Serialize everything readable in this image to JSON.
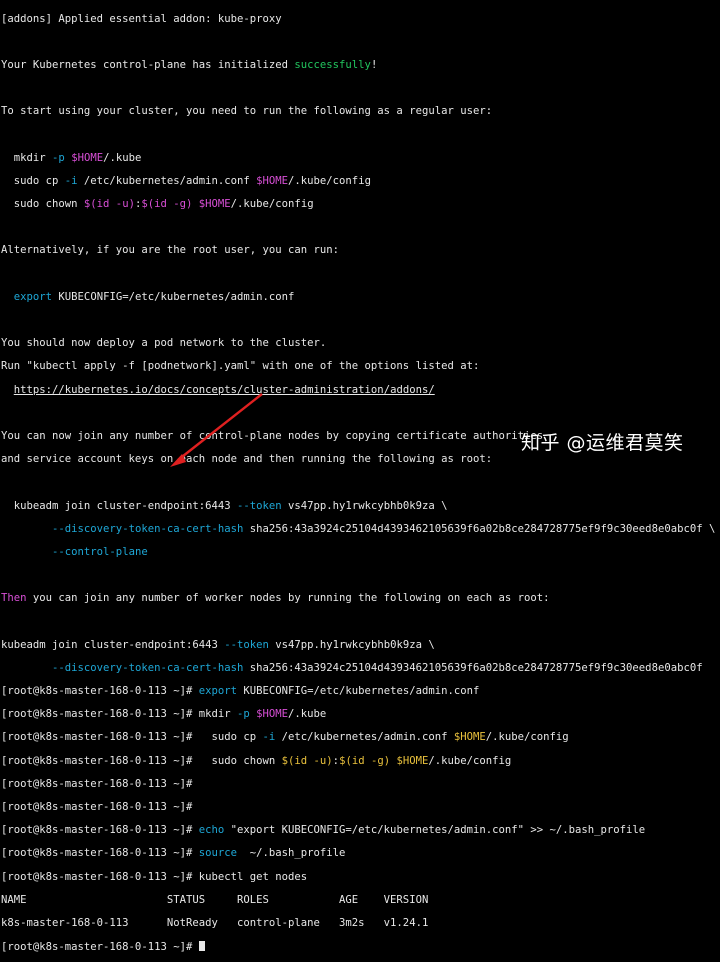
{
  "terminal": {
    "l1": "[addons] Applied essential addon: kube-proxy",
    "l3a": "Your Kubernetes control-plane has initialized ",
    "l3b": "successfully",
    "l3c": "!",
    "l5": "To start using your cluster, you need to run the following as a regular user:",
    "l7a": "  mkdir ",
    "l7b": "-p",
    "l7c": " ",
    "l7d": "$HOME",
    "l7e": "/.kube",
    "l8a": "  sudo cp ",
    "l8b": "-i",
    "l8c": " /etc/kubernetes/admin.conf ",
    "l8d": "$HOME",
    "l8e": "/.kube/config",
    "l9a": "  sudo chown ",
    "l9b": "$(id -u)",
    "l9c": ":",
    "l9d": "$(id -g)",
    "l9e": " ",
    "l9f": "$HOME",
    "l9g": "/.kube/config",
    "l11": "Alternatively, if you are the root user, you can run:",
    "l13a": "  ",
    "l13b": "export",
    "l13c": " KUBECONFIG=/etc/kubernetes/admin.conf",
    "l15": "You should now deploy a pod network to the cluster.",
    "l16": "Run \"kubectl apply -f [podnetwork].yaml\" with one of the options listed at:",
    "l17a": "  ",
    "l17b": "https://kubernetes.io/docs/concepts/cluster-administration/addons/",
    "l19": "You can now join any number of control-plane nodes by copying certificate authorities",
    "l20": "and service account keys on each node and then running the following as root:",
    "l22a": "  kubeadm join cluster-endpoint:6443 ",
    "l22b": "--token",
    "l22c": " vs47pp.hy1rwkcybhb0k9za \\",
    "l23a": "        ",
    "l23b": "--discovery-token-ca-cert-hash",
    "l23c": " sha256:43a3924c25104d4393462105639f6a02b8ce284728775ef9f9c30eed8e0abc0f \\",
    "l24a": "        ",
    "l24b": "--control-plane",
    "l26a": "Then",
    "l26b": " you can join any number of worker nodes by running the following on each as root:",
    "l28a": "kubeadm join cluster-endpoint:6443 ",
    "l28b": "--token",
    "l28c": " vs47pp.hy1rwkcybhb0k9za \\",
    "l29a": "        ",
    "l29b": "--discovery-token-ca-cert-hash",
    "l29c": " sha256:43a3924c25104d4393462105639f6a02b8ce284728775ef9f9c30eed8e0abc0f",
    "prompt": "[root@k8s-master-168-0-113 ~]# ",
    "l30a": "export",
    "l30b": " KUBECONFIG=/etc/kubernetes/admin.conf",
    "l31a": "mkdir ",
    "l31b": "-p",
    "l31c": " ",
    "l31d": "$HOME",
    "l31e": "/.kube",
    "l32a": "  sudo cp ",
    "l32b": "-i",
    "l32c": " /etc/kubernetes/admin.conf ",
    "l32d": "$HOME",
    "l32e": "/.kube/config",
    "l33a": "  sudo chown ",
    "l33b": "$(id -u)",
    "l33c": ":",
    "l33d": "$(id -g)",
    "l33e": " ",
    "l33f": "$HOME",
    "l33g": "/.kube/config",
    "l36a": "echo",
    "l36b": " \"export KUBECONFIG=/etc/kubernetes/admin.conf\" >> ~/.bash_profile",
    "l37a": "source",
    "l37b": "  ~/.bash_profile",
    "l38": "kubectl get nodes",
    "l39": "NAME                      STATUS     ROLES           AGE    VERSION",
    "l40": "k8s-master-168-0-113      NotReady   control-plane   3m2s   v1.24.1",
    "watermark": "知乎 @运维君莫笑",
    "colors": {
      "background": "#000000",
      "text": "#e8e8e8",
      "green": "#22c55e",
      "cyan": "#1ea7d6",
      "yellow": "#e9c13c",
      "magenta": "#d84fd6",
      "arrow": "#e02020"
    }
  }
}
